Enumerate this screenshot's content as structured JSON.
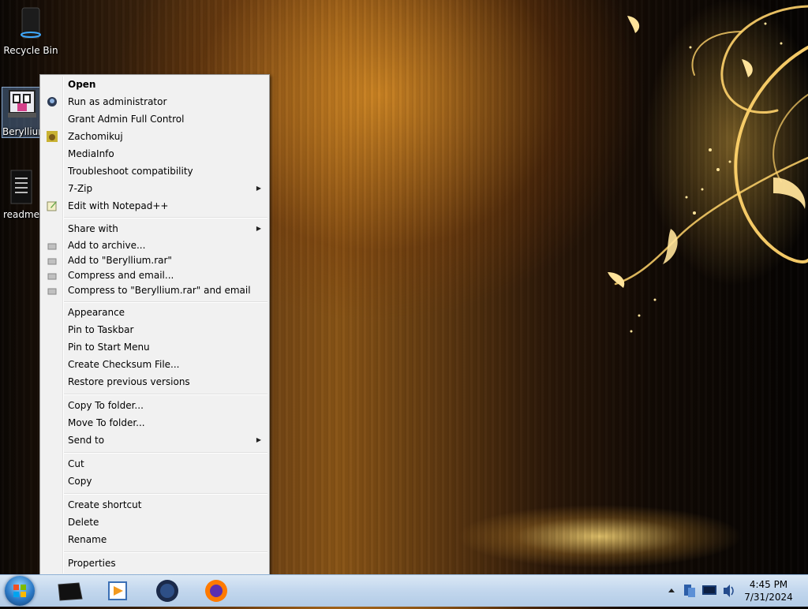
{
  "desktop": {
    "icons": [
      {
        "label": "Recycle Bin"
      },
      {
        "label": "Beryllium"
      },
      {
        "label": "readme"
      }
    ]
  },
  "menu": {
    "items": [
      {
        "label": "Open"
      },
      {
        "label": "Run as administrator",
        "icon": "shield-icon"
      },
      {
        "label": "Grant Admin Full Control"
      },
      {
        "label": "Zachomikuj",
        "icon": "hamster-icon"
      },
      {
        "label": "MediaInfo"
      },
      {
        "label": "Troubleshoot compatibility"
      },
      {
        "label": "7-Zip"
      },
      {
        "label": "Edit with Notepad++",
        "icon": "notepad-icon"
      },
      {
        "label": "Share with"
      },
      {
        "label": "Add to archive...",
        "icon": "winrar-icon"
      },
      {
        "label": "Add to \"Beryllium.rar\"",
        "icon": "winrar-icon"
      },
      {
        "label": "Compress and email...",
        "icon": "winrar-icon"
      },
      {
        "label": "Compress to \"Beryllium.rar\" and email",
        "icon": "winrar-icon"
      },
      {
        "label": "Appearance"
      },
      {
        "label": "Pin to Taskbar"
      },
      {
        "label": "Pin to Start Menu"
      },
      {
        "label": "Create Checksum File..."
      },
      {
        "label": "Restore previous versions"
      },
      {
        "label": "Copy To folder..."
      },
      {
        "label": "Move To folder..."
      },
      {
        "label": "Send to"
      },
      {
        "label": "Cut"
      },
      {
        "label": "Copy"
      },
      {
        "label": "Create shortcut"
      },
      {
        "label": "Delete"
      },
      {
        "label": "Rename"
      },
      {
        "label": "Properties"
      }
    ]
  },
  "taskbar": {
    "pinned": [
      {
        "icon": "terminal-icon"
      },
      {
        "icon": "media-player-icon"
      },
      {
        "icon": "globe-icon"
      },
      {
        "icon": "firefox-icon"
      }
    ],
    "tray": [
      {
        "icon": "chevron-up-icon"
      },
      {
        "icon": "network-icon"
      },
      {
        "icon": "display-icon"
      },
      {
        "icon": "volume-icon"
      }
    ],
    "clock": {
      "time": "4:45 PM",
      "date": "7/31/2024"
    }
  },
  "colors": {
    "menu_bg": "#f1f1f1",
    "taskbar": "#c4d8ee",
    "accent_gold": "#f5b531"
  }
}
